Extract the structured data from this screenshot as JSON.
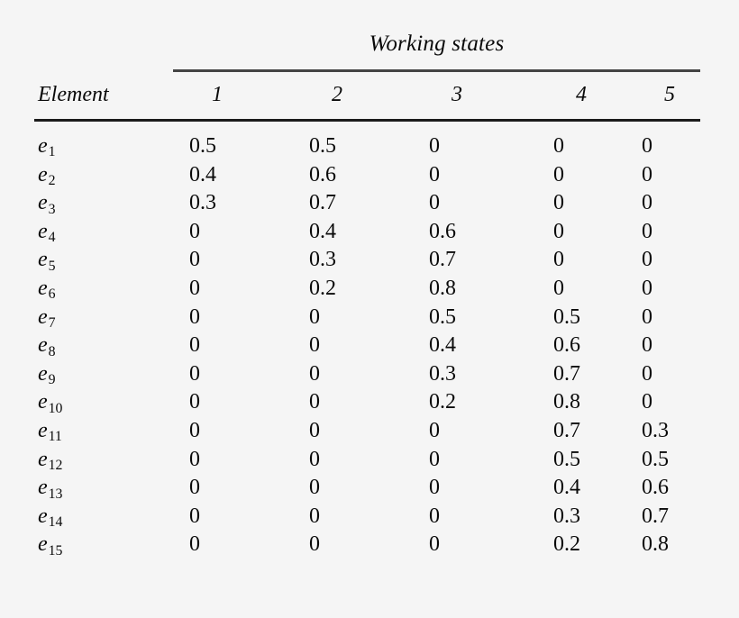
{
  "table": {
    "spanner_title": "Working states",
    "row_header_label": "Element",
    "column_headers": [
      "1",
      "2",
      "3",
      "4",
      "5"
    ],
    "row_labels": [
      {
        "base": "e",
        "sub": "1"
      },
      {
        "base": "e",
        "sub": "2"
      },
      {
        "base": "e",
        "sub": "3"
      },
      {
        "base": "e",
        "sub": "4"
      },
      {
        "base": "e",
        "sub": "5"
      },
      {
        "base": "e",
        "sub": "6"
      },
      {
        "base": "e",
        "sub": "7"
      },
      {
        "base": "e",
        "sub": "8"
      },
      {
        "base": "e",
        "sub": "9"
      },
      {
        "base": "e",
        "sub": "10"
      },
      {
        "base": "e",
        "sub": "11"
      },
      {
        "base": "e",
        "sub": "12"
      },
      {
        "base": "e",
        "sub": "13"
      },
      {
        "base": "e",
        "sub": "14"
      },
      {
        "base": "e",
        "sub": "15"
      }
    ],
    "rows": [
      [
        "0.5",
        "0.5",
        "0",
        "0",
        "0"
      ],
      [
        "0.4",
        "0.6",
        "0",
        "0",
        "0"
      ],
      [
        "0.3",
        "0.7",
        "0",
        "0",
        "0"
      ],
      [
        "0",
        "0.4",
        "0.6",
        "0",
        "0"
      ],
      [
        "0",
        "0.3",
        "0.7",
        "0",
        "0"
      ],
      [
        "0",
        "0.2",
        "0.8",
        "0",
        "0"
      ],
      [
        "0",
        "0",
        "0.5",
        "0.5",
        "0"
      ],
      [
        "0",
        "0",
        "0.4",
        "0.6",
        "0"
      ],
      [
        "0",
        "0",
        "0.3",
        "0.7",
        "0"
      ],
      [
        "0",
        "0",
        "0.2",
        "0.8",
        "0"
      ],
      [
        "0",
        "0",
        "0",
        "0.7",
        "0.3"
      ],
      [
        "0",
        "0",
        "0",
        "0.5",
        "0.5"
      ],
      [
        "0",
        "0",
        "0",
        "0.4",
        "0.6"
      ],
      [
        "0",
        "0",
        "0",
        "0.3",
        "0.7"
      ],
      [
        "0",
        "0",
        "0",
        "0.2",
        "0.8"
      ]
    ],
    "colors": {
      "background": "#f5f5f5",
      "text": "#0a0a0a",
      "rule_header": "#1b1b1b",
      "rule_spanner": "#444444"
    }
  }
}
